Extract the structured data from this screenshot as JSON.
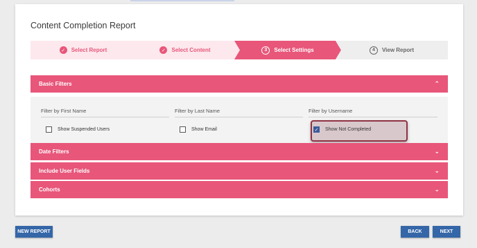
{
  "page": {
    "title": "Content Completion Report"
  },
  "stepper": {
    "steps": [
      {
        "label": "Select Report",
        "state": "done",
        "marker": "✓"
      },
      {
        "label": "Select Content",
        "state": "done",
        "marker": "✓"
      },
      {
        "label": "Select Settings",
        "state": "active",
        "marker": "3"
      },
      {
        "label": "View Report",
        "state": "todo",
        "marker": "4"
      }
    ]
  },
  "sections": {
    "basic": {
      "label": "Basic Filters",
      "expanded": true
    },
    "date": {
      "label": "Date Filters",
      "expanded": false
    },
    "user_fields": {
      "label": "Include User Fields",
      "expanded": false
    },
    "cohorts": {
      "label": "Cohorts",
      "expanded": false
    }
  },
  "filters": {
    "first_name": {
      "placeholder": "Filter by First Name",
      "value": ""
    },
    "last_name": {
      "placeholder": "Filter by Last Name",
      "value": ""
    },
    "username": {
      "placeholder": "Filter by Username",
      "value": ""
    },
    "show_suspended": {
      "label": "Show Suspended Users",
      "checked": false
    },
    "show_email": {
      "label": "Show Email",
      "checked": false
    },
    "show_not_completed": {
      "label": "Show Not Completed",
      "checked": true
    }
  },
  "buttons": {
    "new_report": "NEW REPORT",
    "back": "BACK",
    "next": "NEXT"
  },
  "colors": {
    "accent": "#e8567a",
    "accent_light": "#fce8ed",
    "button_blue": "#3466a8",
    "highlight_border": "#8e3344"
  },
  "icons": {
    "chevron_up": "chevron-up-icon",
    "chevron_down": "chevron-down-icon",
    "check": "check-circle-icon"
  }
}
